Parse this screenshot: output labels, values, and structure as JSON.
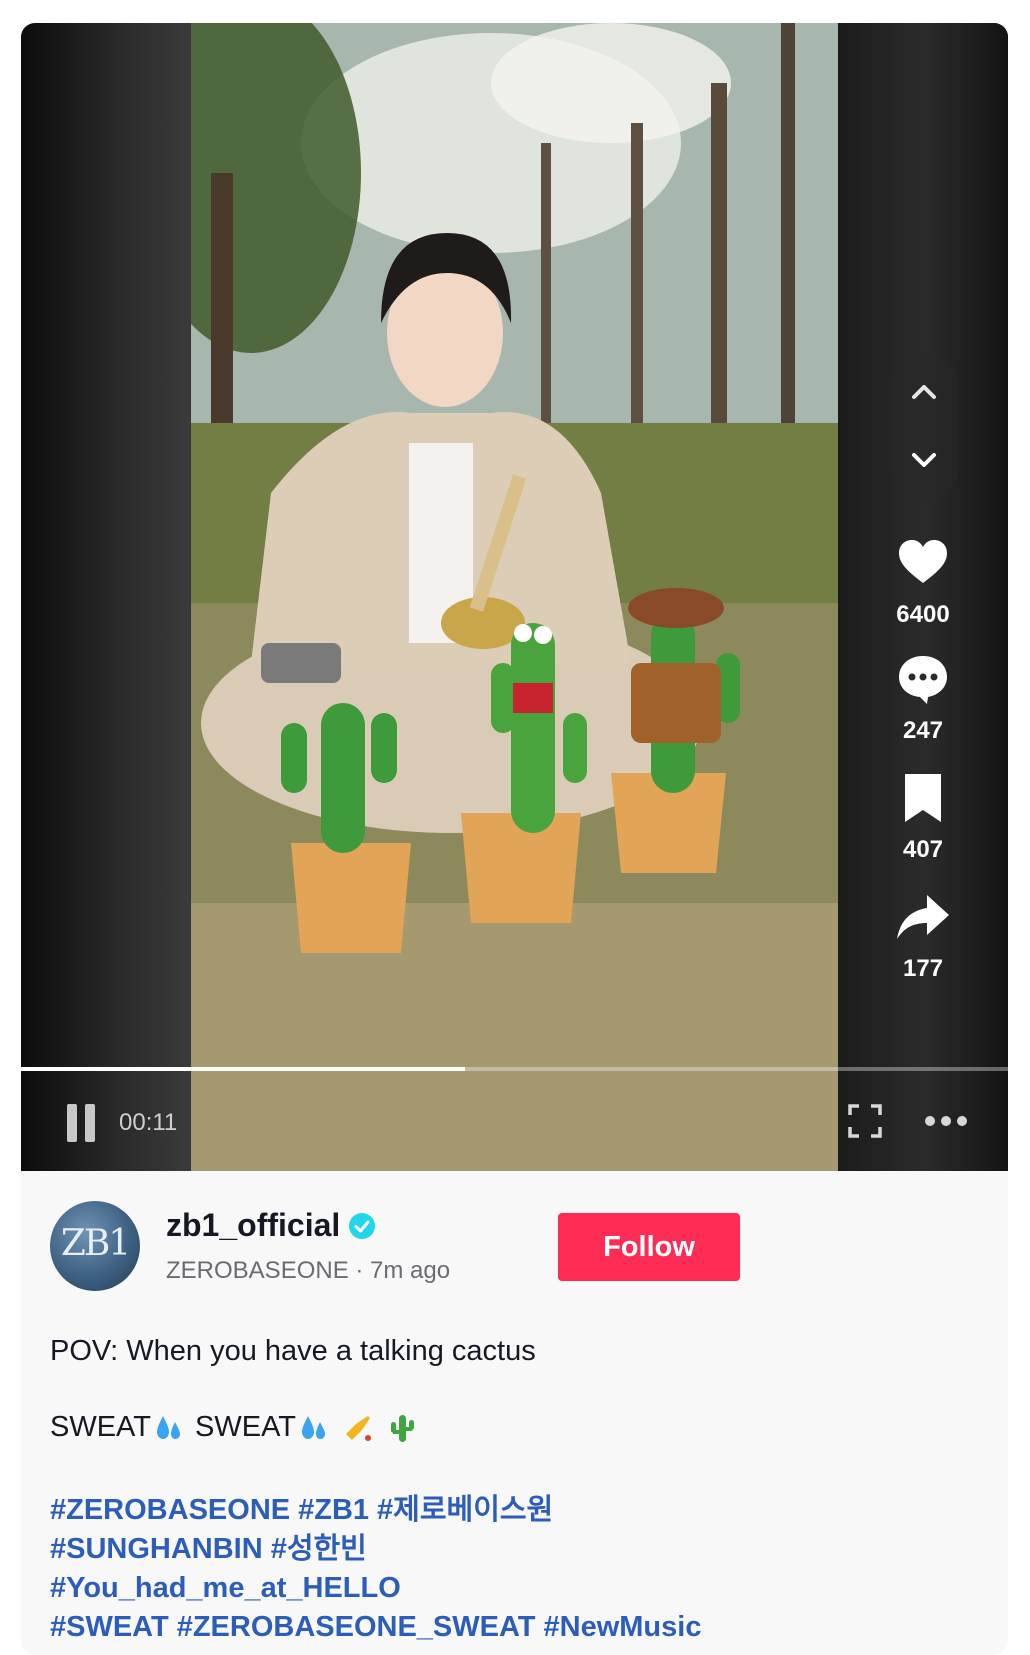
{
  "video": {
    "elapsed": "00:11",
    "progress_fraction": 0.45
  },
  "actions": {
    "likes": "6400",
    "comments": "247",
    "saves": "407",
    "shares": "177"
  },
  "icons": {
    "like": "heart-icon",
    "comment": "comment-icon",
    "save": "bookmark-icon",
    "share": "share-icon",
    "nav_up": "chevron-up-icon",
    "nav_down": "chevron-down-icon",
    "pause": "pause-icon",
    "fullscreen": "fullscreen-icon",
    "more": "more-icon",
    "verified": "verified-badge-icon"
  },
  "author": {
    "avatar_text": "ZB1",
    "username": "zb1_official",
    "display_name": "ZEROBASEONE",
    "separator": " · ",
    "posted": "7m ago",
    "follow_label": "Follow"
  },
  "description": {
    "line1": "POV: When you have a talking cactus",
    "line2_word1": "SWEAT",
    "line2_word2": "SWEAT"
  },
  "hashtags": [
    [
      "#ZEROBASEONE",
      "#ZB1",
      "#제로베이스원"
    ],
    [
      "#SUNGHANBIN",
      "#성한빈"
    ],
    [
      "#You_had_me_at_HELLO"
    ],
    [
      "#SWEAT",
      "#ZEROBASEONE_SWEAT",
      "#NewMusic"
    ]
  ],
  "colors": {
    "follow_button": "#fe2c55",
    "hashtag": "#2b5db9",
    "verified": "#20d5ec"
  }
}
